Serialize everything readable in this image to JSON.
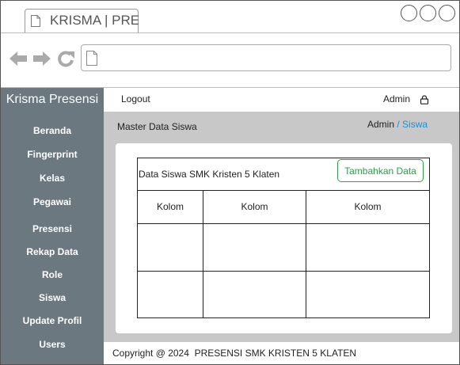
{
  "browser": {
    "tab_title": "KRISMA | PRESENSI",
    "url": ""
  },
  "app": {
    "brand": "Krisma Presensi",
    "logout_label": "Logout",
    "user_label": "Admin",
    "user_icon": "lock-user-icon"
  },
  "sidebar": {
    "items": [
      {
        "label": "Beranda"
      },
      {
        "label": "Fingerprint"
      },
      {
        "label": "Kelas"
      },
      {
        "label": "Pegawai"
      },
      {
        "label": "Presensi"
      },
      {
        "label": "Rekap Data"
      },
      {
        "label": "Role"
      },
      {
        "label": "Siswa"
      },
      {
        "label": "Update Profil"
      },
      {
        "label": "Users"
      }
    ]
  },
  "main": {
    "page_title": "Master Data Siswa",
    "breadcrumb": {
      "root": "Admin",
      "separator": " / ",
      "current": "Siswa"
    },
    "table_caption": "Data Siswa SMK Kristen 5 Klaten",
    "add_button": "Tambahkan Data",
    "columns": [
      "Kolom",
      "Kolom",
      "Kolom"
    ]
  },
  "footer": {
    "text": "Copyright @ 2024  PRESENSI SMK KRISTEN 5 KLATEN"
  },
  "colors": {
    "sidebar_bg": "#6c7880",
    "content_bg": "#c8c8c8",
    "accent_green": "#2e9b4a",
    "link_blue": "#1a8fd8"
  }
}
